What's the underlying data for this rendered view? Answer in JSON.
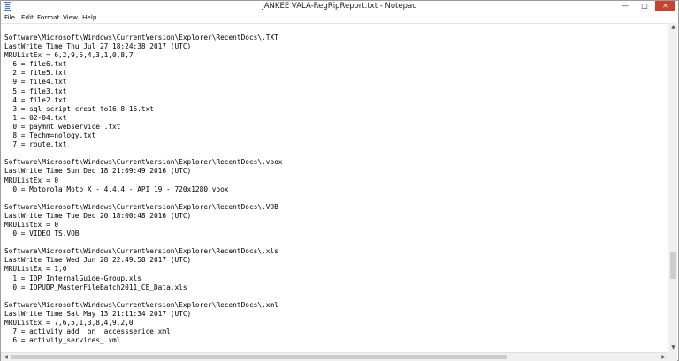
{
  "window": {
    "title": "JANKEE VALA-RegRipReport.txt - Notepad",
    "controls": {
      "minimize": "—",
      "maximize": "□",
      "close": "✕"
    }
  },
  "menu": [
    "File",
    "Edit",
    "Format",
    "View",
    "Help"
  ],
  "lines": [
    "Software\\Microsoft\\Windows\\CurrentVersion\\Explorer\\RecentDocs\\.TXT",
    "LastWrite Time Thu Jul 27 18:24:38 2017 (UTC)",
    "MRUListEx = 6,2,9,5,4,3,1,0,8,7",
    "  6 = file6.txt",
    "  2 = file5.txt",
    "  9 = file4.txt",
    "  5 = file3.txt",
    "  4 = file2.txt",
    "  3 = sql script creat to16-8-16.txt",
    "  1 = 02-04.txt",
    "  0 = paymnt webservice .txt",
    "  8 = Techm=nology.txt",
    "  7 = route.txt",
    "",
    "Software\\Microsoft\\Windows\\CurrentVersion\\Explorer\\RecentDocs\\.vbox",
    "LastWrite Time Sun Dec 18 21:09:49 2016 (UTC)",
    "MRUListEx = 0",
    "  0 = Motorola Moto X - 4.4.4 - API 19 - 720x1280.vbox",
    "",
    "Software\\Microsoft\\Windows\\CurrentVersion\\Explorer\\RecentDocs\\.VOB",
    "LastWrite Time Tue Dec 20 18:00:48 2016 (UTC)",
    "MRUListEx = 0",
    "  0 = VIDEO_TS.VOB",
    "",
    "Software\\Microsoft\\Windows\\CurrentVersion\\Explorer\\RecentDocs\\.xls",
    "LastWrite Time Wed Jun 28 22:49:58 2017 (UTC)",
    "MRUListEx = 1,0",
    "  1 = IDP_InternalGuide-Group.xls",
    "  0 = IDPUDP_MasterFileBatch2011_CE_Data.xls",
    "",
    "Software\\Microsoft\\Windows\\CurrentVersion\\Explorer\\RecentDocs\\.xml",
    "LastWrite Time Sat May 13 21:11:34 2017 (UTC)",
    "MRUListEx = 7,6,5,1,3,8,4,9,2,0",
    "  7 = activity_add__on__accessserice.xml",
    "  6 = activity_services_.xml"
  ],
  "scrollbars": {
    "up": "▲",
    "down": "▼",
    "left": "◀",
    "right": "▶"
  }
}
